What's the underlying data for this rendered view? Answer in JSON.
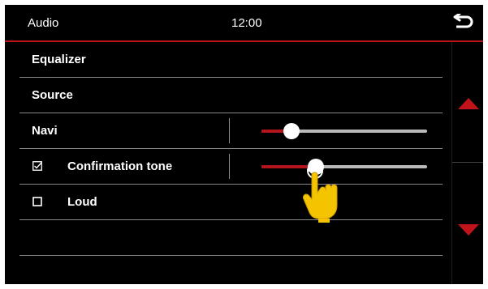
{
  "header": {
    "title": "Audio",
    "time": "12:00",
    "back_icon": "back-arrow-icon"
  },
  "menu": {
    "equalizer_label": "Equalizer",
    "source_label": "Source"
  },
  "navi": {
    "label": "Navi",
    "volume_level": 0.18
  },
  "confirmation_tone": {
    "label": "Confirmation tone",
    "checked": true,
    "volume_level": 0.33
  },
  "loud": {
    "label": "Loud",
    "checked": false
  },
  "scroll": {
    "up_icon": "scroll-up-arrow-icon",
    "down_icon": "scroll-down-arrow-icon"
  },
  "colors": {
    "accent": "#c0141a",
    "background": "#000000",
    "text": "#ffffff",
    "track": "#b9b9b9",
    "divider": "#8a8a8a",
    "pointer_hand": "#f5c400"
  }
}
